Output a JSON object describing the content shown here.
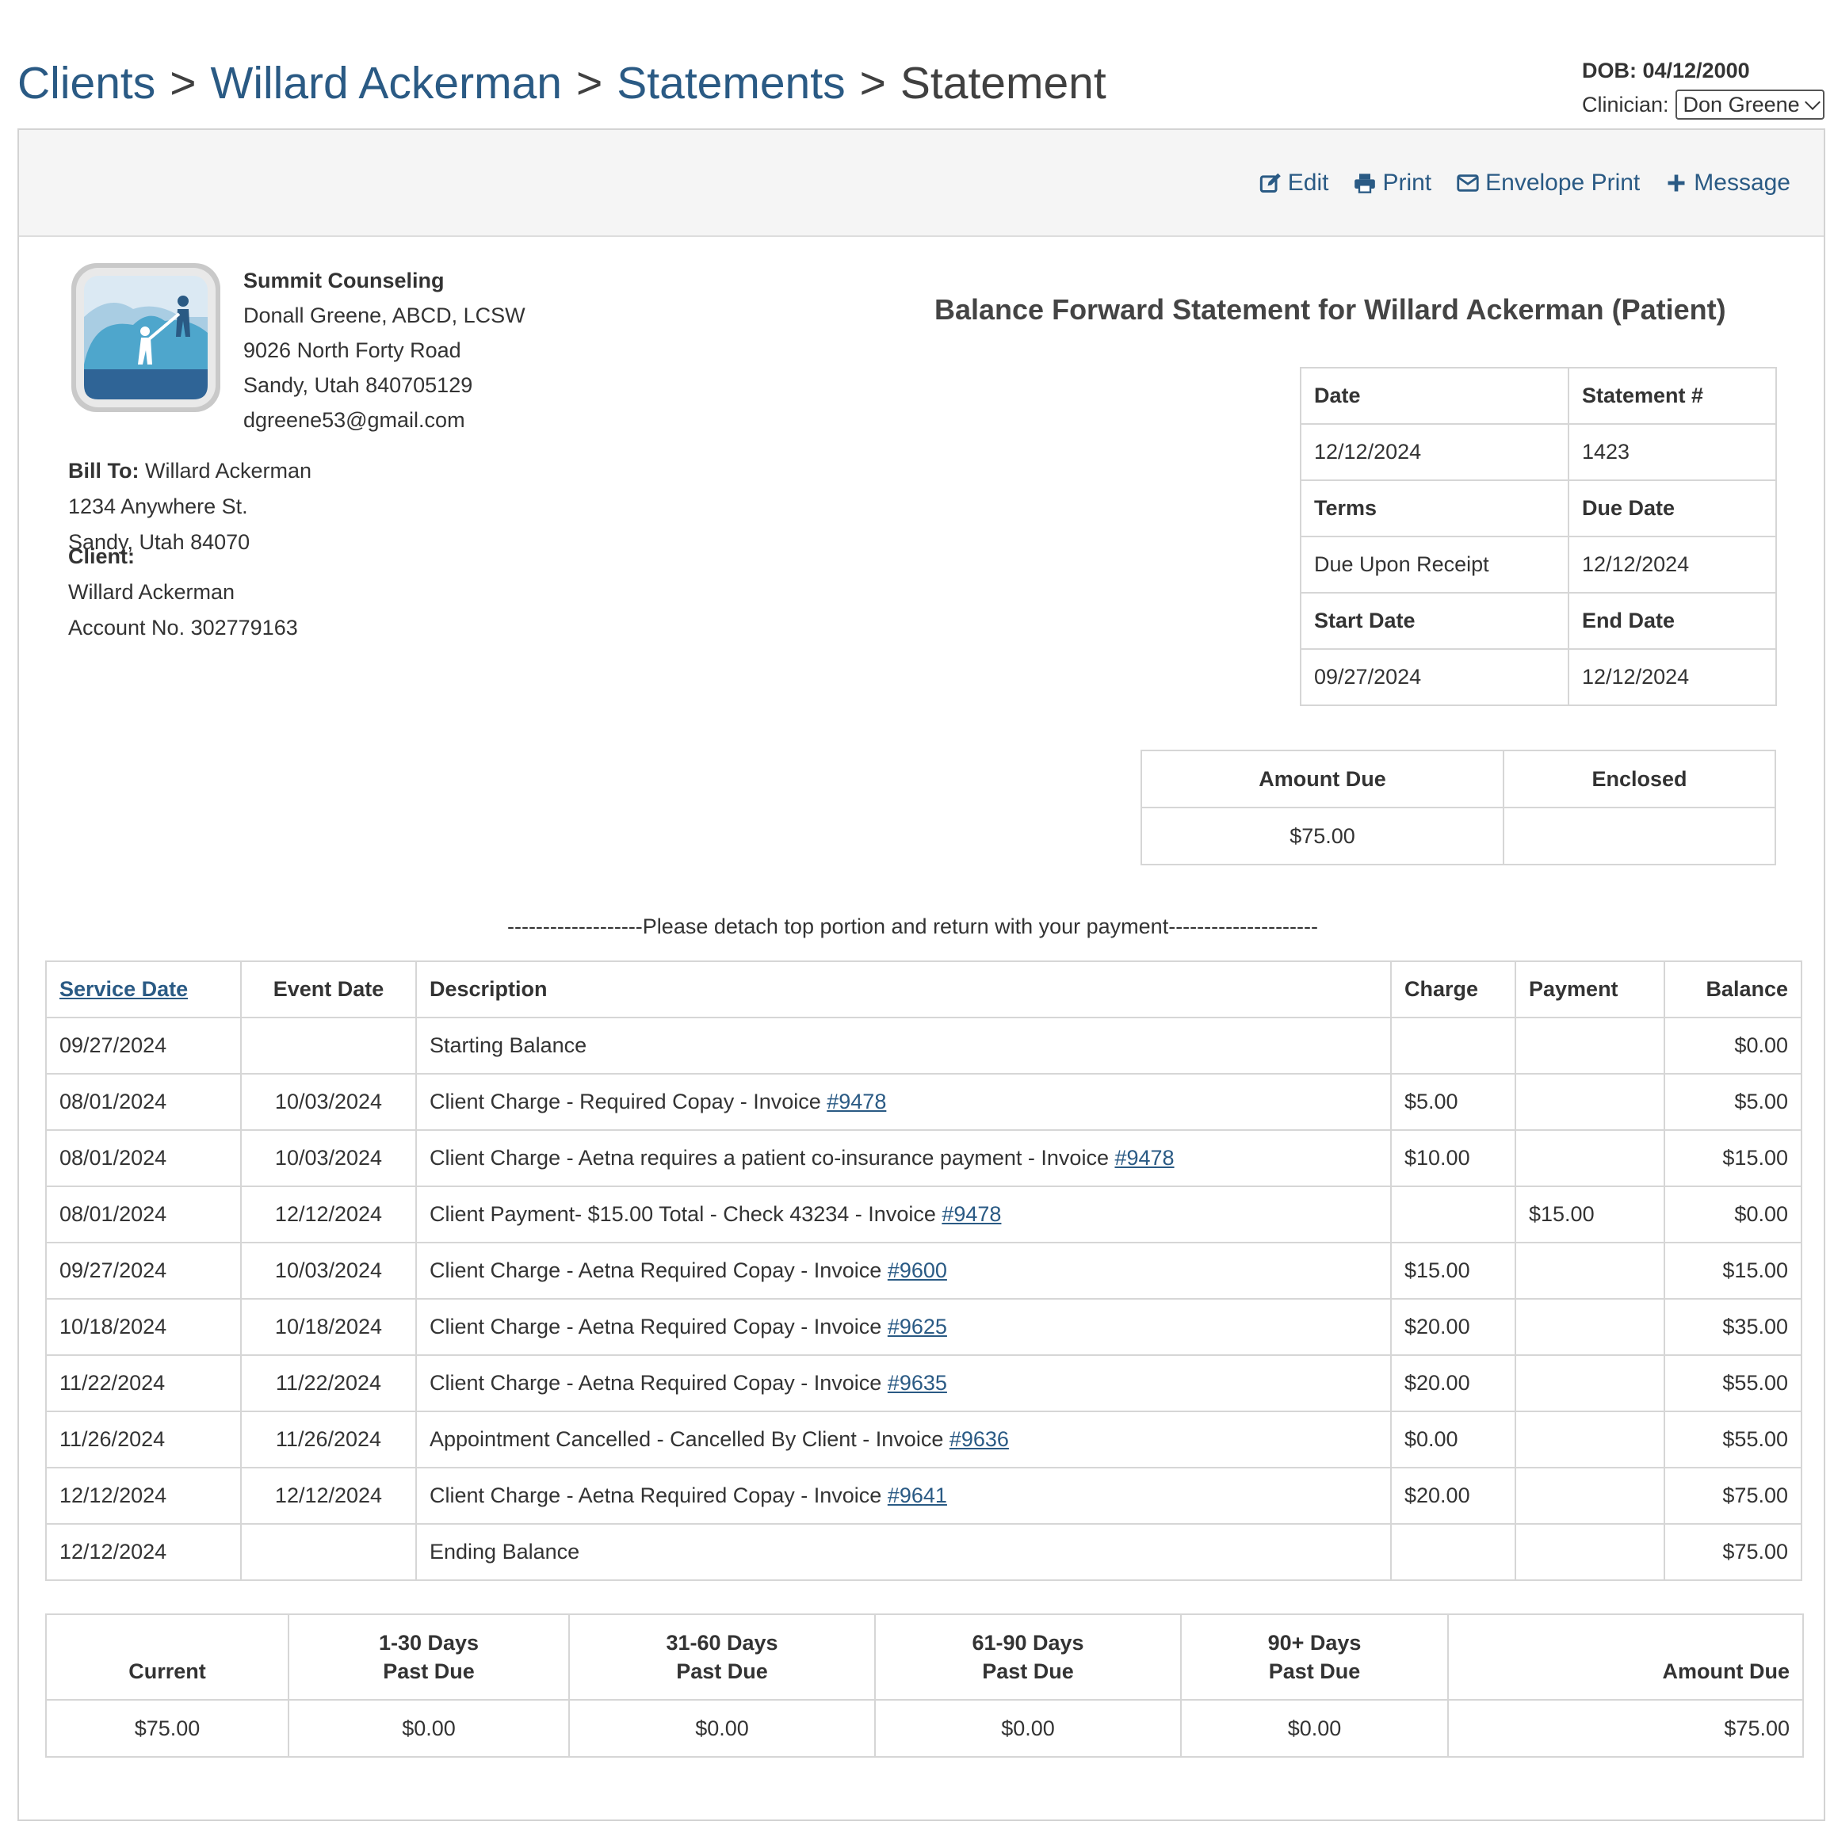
{
  "breadcrumb": {
    "clients": "Clients",
    "client_name": "Willard Ackerman",
    "statements": "Statements",
    "current": "Statement",
    "separator": ">"
  },
  "header": {
    "dob": "DOB: 04/12/2000",
    "clinician_label": "Clinician:",
    "clinician_value": "Don Greene"
  },
  "actions": {
    "edit": "Edit",
    "print": "Print",
    "envelope_print": "Envelope Print",
    "message": "Message"
  },
  "org": {
    "name": "Summit Counseling",
    "provider": "Donall Greene, ABCD, LCSW",
    "address1": "9026 North Forty Road",
    "address2": "Sandy, Utah 840705129",
    "email": "dgreene53@gmail.com"
  },
  "bill_to": {
    "label": "Bill To:",
    "name": "Willard Ackerman",
    "address1": "1234 Anywhere St.",
    "address2": "Sandy, Utah 84070"
  },
  "client": {
    "label": "Client:",
    "name": "Willard Ackerman",
    "account": "Account No. 302779163"
  },
  "statement_title": "Balance Forward Statement for Willard Ackerman (Patient)",
  "info": {
    "date_label": "Date",
    "statement_no_label": "Statement #",
    "date": "12/12/2024",
    "statement_no": "1423",
    "terms_label": "Terms",
    "due_date_label": "Due Date",
    "terms": "Due Upon Receipt",
    "due_date": "12/12/2024",
    "start_label": "Start Date",
    "end_label": "End Date",
    "start": "09/27/2024",
    "end": "12/12/2024"
  },
  "amount_box": {
    "amount_due_label": "Amount Due",
    "enclosed_label": "Enclosed",
    "amount_due": "$75.00",
    "enclosed": ""
  },
  "detach_text": "-------------------Please detach top portion and return with your payment---------------------",
  "transactions": {
    "headers": {
      "service_date": "Service Date",
      "event_date": "Event Date",
      "description": "Description",
      "charge": "Charge",
      "payment": "Payment",
      "balance": "Balance"
    },
    "rows": [
      {
        "service_date": "09/27/2024",
        "event_date": "",
        "description": "Starting Balance",
        "invoice": "",
        "charge": "",
        "payment": "",
        "balance": "$0.00"
      },
      {
        "service_date": "08/01/2024",
        "event_date": "10/03/2024",
        "description": "Client Charge - Required Copay - Invoice ",
        "invoice": "#9478",
        "charge": "$5.00",
        "payment": "",
        "balance": "$5.00"
      },
      {
        "service_date": "08/01/2024",
        "event_date": "10/03/2024",
        "description": "Client Charge - Aetna requires a patient co-insurance payment - Invoice ",
        "invoice": "#9478",
        "charge": "$10.00",
        "payment": "",
        "balance": "$15.00"
      },
      {
        "service_date": "08/01/2024",
        "event_date": "12/12/2024",
        "description": "Client Payment- $15.00 Total - Check 43234 - Invoice ",
        "invoice": "#9478",
        "charge": "",
        "payment": "$15.00",
        "balance": "$0.00"
      },
      {
        "service_date": "09/27/2024",
        "event_date": "10/03/2024",
        "description": "Client Charge - Aetna Required Copay - Invoice ",
        "invoice": "#9600",
        "charge": "$15.00",
        "payment": "",
        "balance": "$15.00"
      },
      {
        "service_date": "10/18/2024",
        "event_date": "10/18/2024",
        "description": "Client Charge - Aetna Required Copay - Invoice ",
        "invoice": "#9625",
        "charge": "$20.00",
        "payment": "",
        "balance": "$35.00"
      },
      {
        "service_date": "11/22/2024",
        "event_date": "11/22/2024",
        "description": "Client Charge - Aetna Required Copay - Invoice ",
        "invoice": "#9635",
        "charge": "$20.00",
        "payment": "",
        "balance": "$55.00"
      },
      {
        "service_date": "11/26/2024",
        "event_date": "11/26/2024",
        "description": "Appointment Cancelled - Cancelled By Client - Invoice ",
        "invoice": "#9636",
        "charge": "$0.00",
        "payment": "",
        "balance": "$55.00"
      },
      {
        "service_date": "12/12/2024",
        "event_date": "12/12/2024",
        "description": "Client Charge - Aetna Required Copay - Invoice ",
        "invoice": "#9641",
        "charge": "$20.00",
        "payment": "",
        "balance": "$75.00"
      },
      {
        "service_date": "12/12/2024",
        "event_date": "",
        "description": "Ending Balance",
        "invoice": "",
        "charge": "",
        "payment": "",
        "balance": "$75.00"
      }
    ]
  },
  "aging": {
    "headers": {
      "current": "Current",
      "d1_30_top": "1-30 Days",
      "d1_30_bottom": "Past Due",
      "d31_60_top": "31-60 Days",
      "d31_60_bottom": "Past Due",
      "d61_90_top": "61-90 Days",
      "d61_90_bottom": "Past Due",
      "d90_top": "90+ Days",
      "d90_bottom": "Past Due",
      "amount_due": "Amount Due"
    },
    "values": {
      "current": "$75.00",
      "d1_30": "$0.00",
      "d31_60": "$0.00",
      "d61_90": "$0.00",
      "d90": "$0.00",
      "amount_due": "$75.00"
    }
  },
  "colors": {
    "link": "#2a5a84",
    "border": "#d6d6d6",
    "panel_header": "#f5f5f5"
  },
  "icons": {
    "edit": "edit-icon",
    "print": "printer-icon",
    "envelope": "envelope-icon",
    "message": "plus-icon"
  }
}
